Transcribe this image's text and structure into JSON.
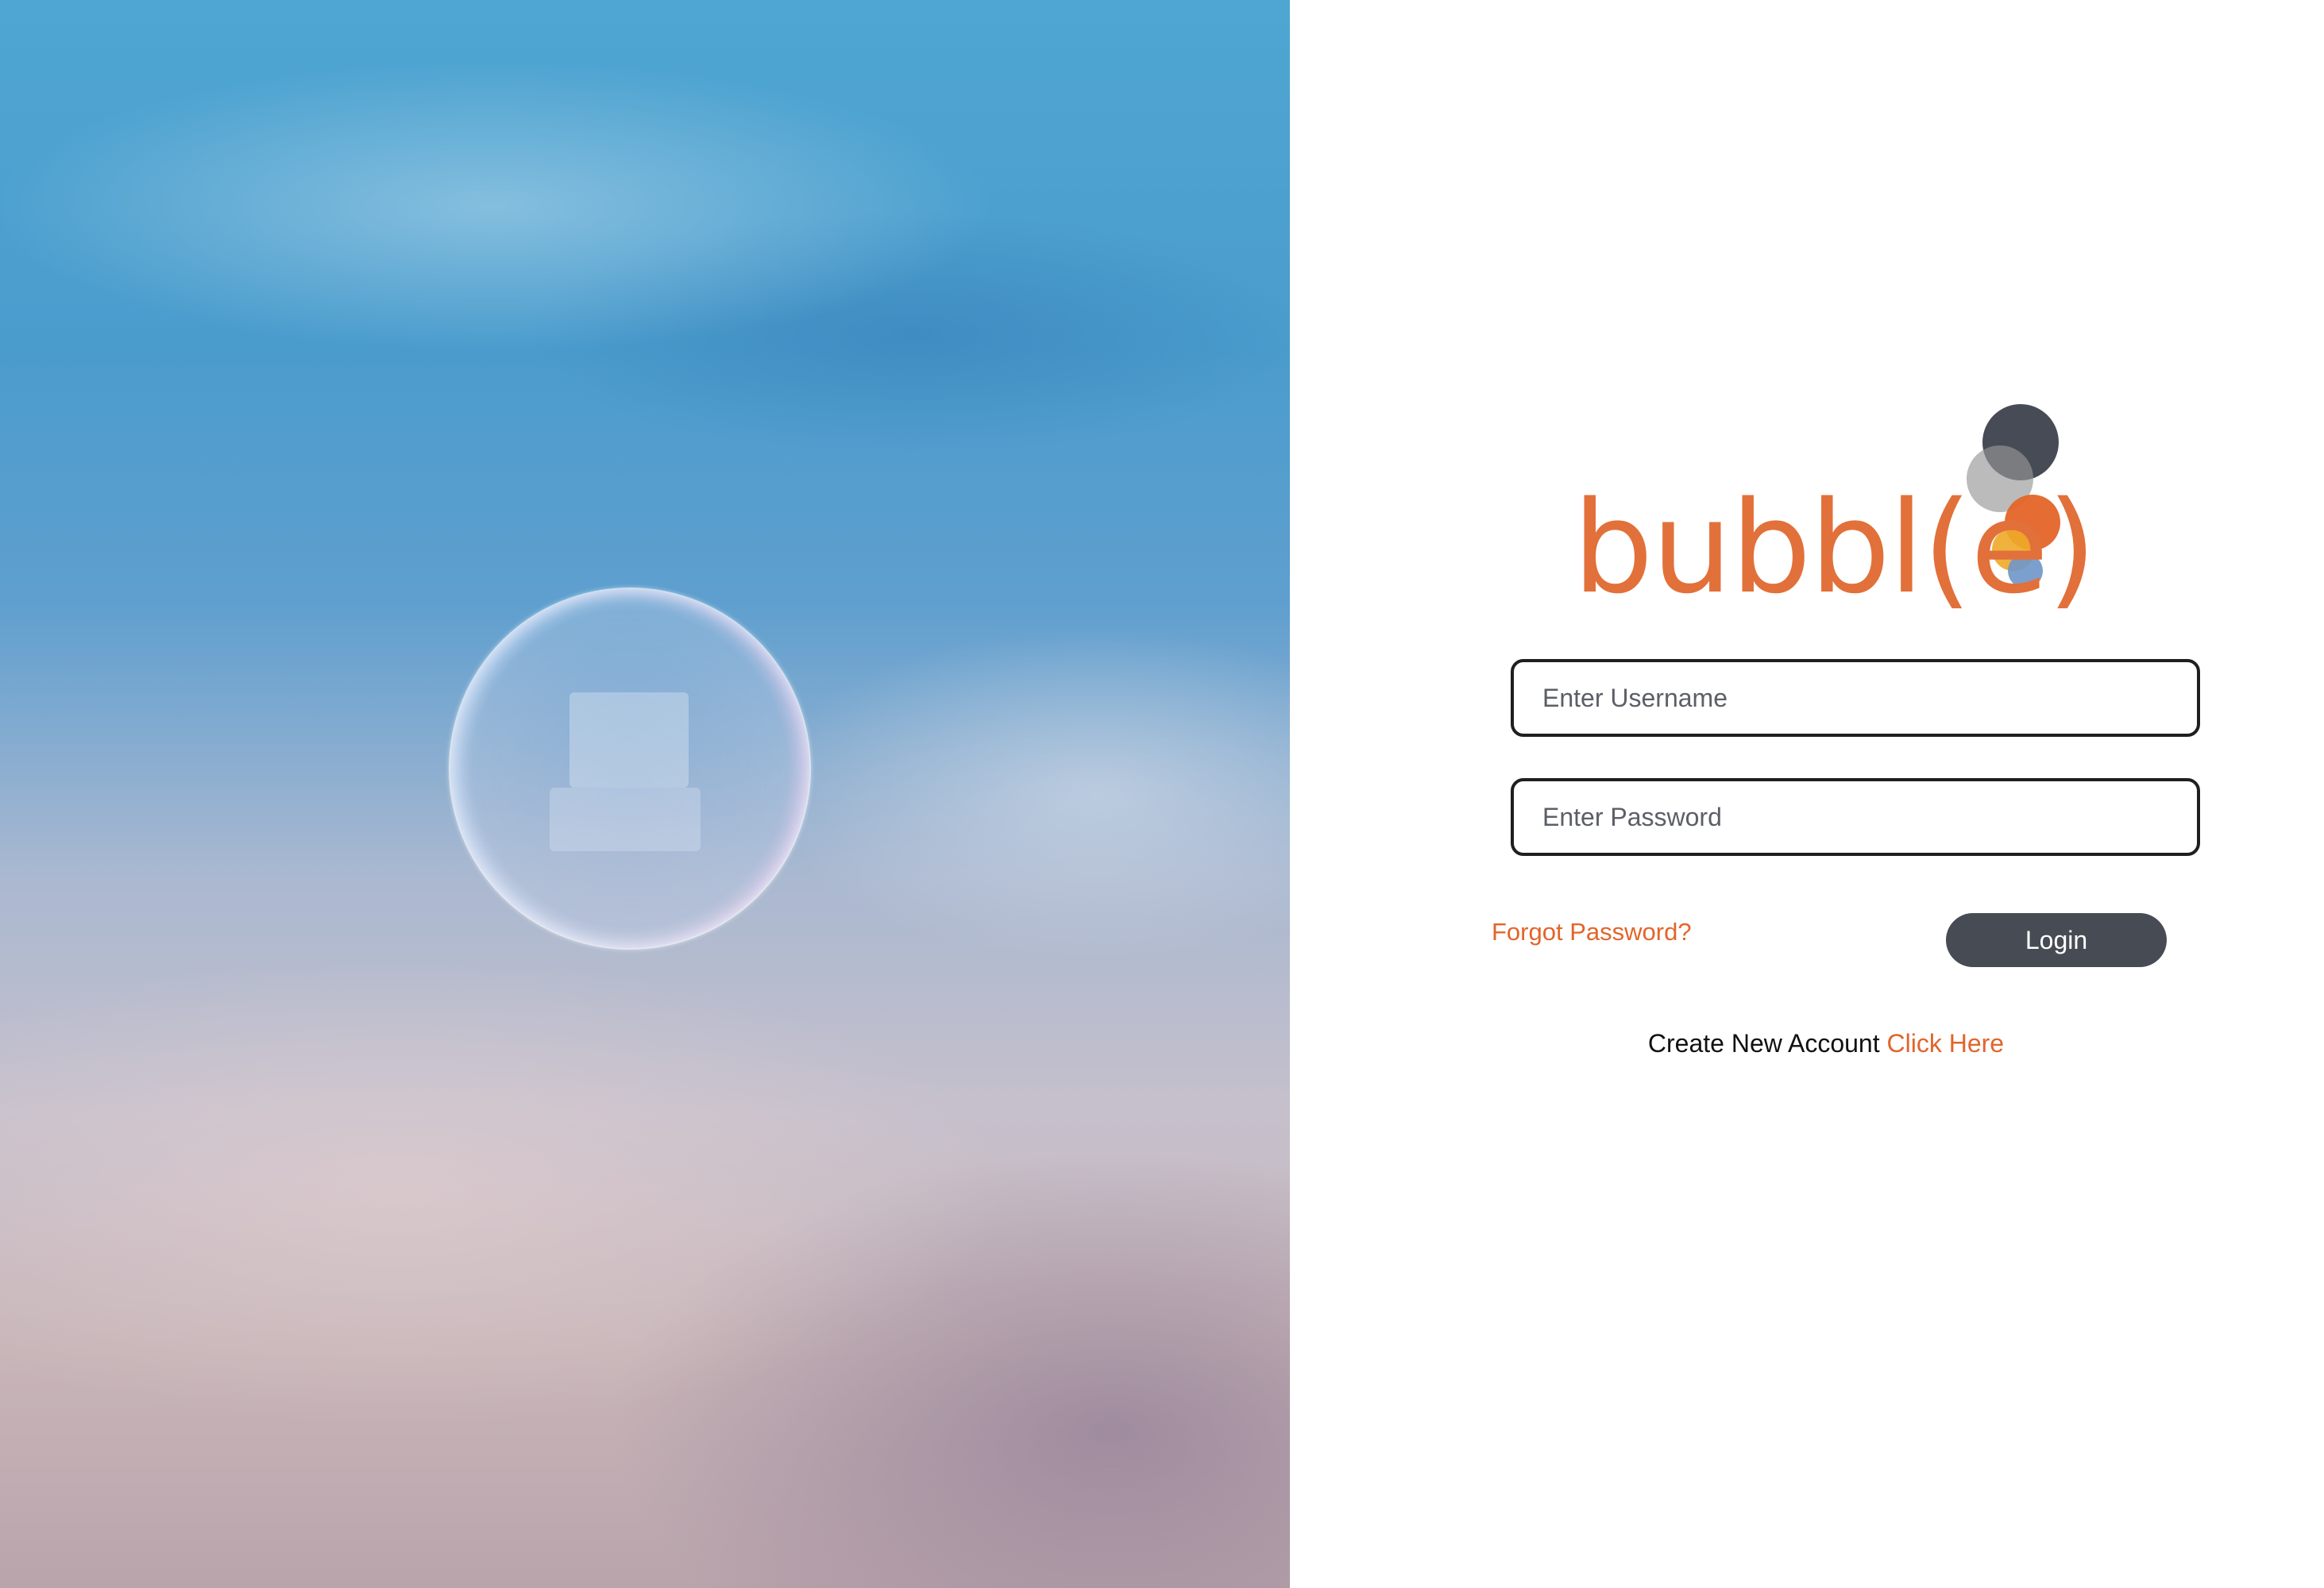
{
  "hero": {
    "image_icon": "soap-bubble-sky-photo"
  },
  "logo": {
    "wordmark": "bubbl(e)",
    "colors": {
      "wordmark": "#e2703a",
      "dot_dark": "#3a3e46",
      "dot_grey": "#9a9a9a",
      "dot_orange": "#e4642a",
      "dot_yellow": "#eeaa28",
      "dot_blue": "#6e96c8"
    }
  },
  "form": {
    "username_placeholder": "Enter Username",
    "username_value": "",
    "password_placeholder": "Enter Password",
    "password_value": "",
    "forgot_label": "Forgot Password?",
    "login_label": "Login"
  },
  "signup": {
    "prompt": "Create New Account",
    "link_label": "Click Here"
  },
  "colors": {
    "accent": "#e2652a",
    "button": "#474b53",
    "border": "#1f1f1f"
  }
}
